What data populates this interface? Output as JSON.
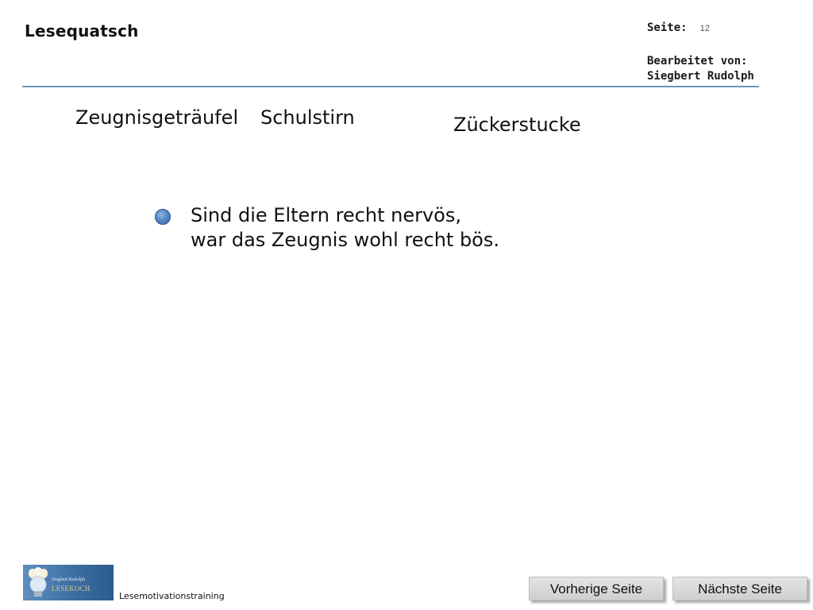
{
  "header": {
    "title": "Lesequatsch",
    "page_label": "Seite:",
    "page_number": "12",
    "editor_label": "Bearbeitet von:",
    "editor_name": "Siegbert Rudolph"
  },
  "words": [
    "Zeugnisgeträufel",
    "Schulstirn",
    "Zückerstucke"
  ],
  "rhyme": {
    "line1": "Sind die Eltern recht nervös,",
    "line2": "war das Zeugnis wohl recht bös."
  },
  "footer": {
    "logo": {
      "name": "Siegbert Rudolph",
      "brand": "LESEKOCH"
    },
    "label": "Lesemotivationstraining",
    "prev_label": "Vorherige Seite",
    "next_label": "Nächste Seite"
  },
  "colors": {
    "rule": "#6f95bd",
    "bullet": "#4f80c4",
    "logo_bg": "#3c6fa3",
    "button_bg": "#d9d9d9"
  },
  "icons": {
    "bullet": "audio-bullet-icon",
    "logo_graphic": "lightbulb-chef-icon"
  }
}
